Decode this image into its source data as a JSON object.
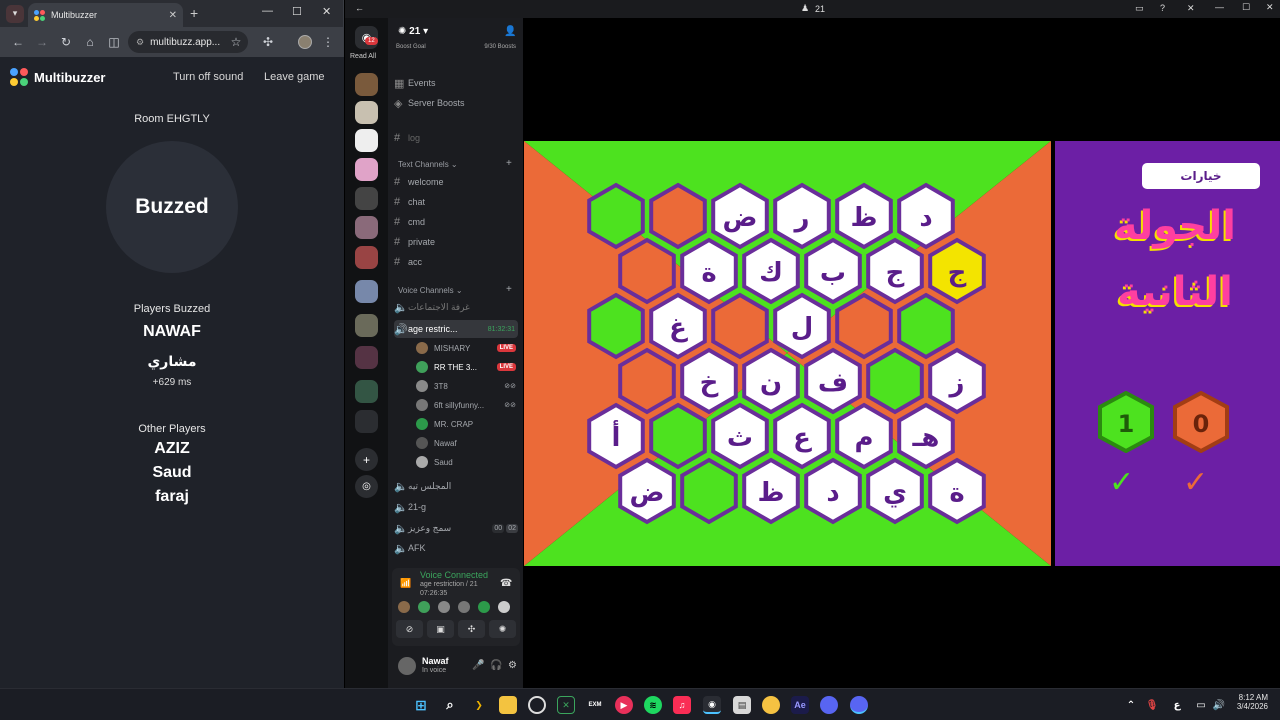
{
  "chrome": {
    "tab_title": "Multibuzzer",
    "tab_close": "✕",
    "new_tab": "+",
    "url": "multibuzz.app...",
    "window_controls": [
      "—",
      "☐",
      "✕"
    ]
  },
  "multibuzzer": {
    "app_name": "Multibuzzer",
    "turn_off_sound": "Turn off sound",
    "leave_game": "Leave game",
    "room": "Room EHGTLY",
    "buzzed": "Buzzed",
    "players_buzzed_label": "Players Buzzed",
    "buzzed_players": [
      {
        "name": "NAWAF",
        "time": ""
      },
      {
        "name": "مشاري",
        "time": "+629 ms"
      }
    ],
    "other_players_label": "Other Players",
    "other_players": [
      "AZIZ",
      "Saud",
      "faraj"
    ]
  },
  "discord": {
    "title_number": "21",
    "read_all": "Read All",
    "badge": "12",
    "server_name": "21",
    "boost_goal": "Boost Goal",
    "boost_count": "9/30 Boosts",
    "menu_items": [
      "Events",
      "Server Boosts"
    ],
    "log_channel": "log",
    "text_channels_label": "Text Channels",
    "text_channels": [
      "welcome",
      "chat",
      "cmd",
      "private",
      "acc"
    ],
    "voice_channels_label": "Voice Channels",
    "voice_channel_meeting": "غرفة الاجتماعات",
    "active_voice_channel": "age restric...",
    "active_voice_timer": "81:32:31",
    "voice_users": [
      {
        "name": "MISHARY",
        "live": "LIVE",
        "color": "#8a6a4a"
      },
      {
        "name": "RR THE 3...",
        "live": "LIVE",
        "color": "#3fa05a"
      },
      {
        "name": "3T8",
        "live": "",
        "color": "#8a8a8a"
      },
      {
        "name": "6ft sillyfunny...",
        "live": "",
        "color": "#777"
      },
      {
        "name": "MR. CRAP",
        "live": "",
        "color": "#2c9a4a"
      },
      {
        "name": "Nawaf",
        "live": "",
        "color": "#555"
      },
      {
        "name": "Saud",
        "live": "",
        "color": "#aaa"
      }
    ],
    "other_voice_channels": [
      "المجلس تيه",
      "21-g",
      "سمج وعزيز",
      "AFK"
    ],
    "vc_counts": [
      "00",
      "02"
    ],
    "voice_connected": "Voice Connected",
    "voice_location": "age restriction / 21",
    "voice_timer": "07:26:35",
    "user_name": "Nawaf",
    "user_status": "In voice"
  },
  "game": {
    "options_button": "خيارات",
    "round_title_line1": "الجولة",
    "round_title_line2": "الثانية",
    "score_green": "1",
    "score_orange": "0",
    "check": "✓",
    "colors": {
      "green": "#4de21f",
      "orange": "#eb6a38",
      "purple": "#6c1fa5",
      "yellow": "#f3e400",
      "hex_border": "#6a2e9a"
    },
    "rows": [
      [
        {
          "t": "",
          "c": "green"
        },
        {
          "t": "",
          "c": "orange"
        },
        {
          "t": "ض",
          "c": "white"
        },
        {
          "t": "ر",
          "c": "white"
        },
        {
          "t": "ظ",
          "c": "white"
        },
        {
          "t": "د",
          "c": "white"
        }
      ],
      [
        {
          "t": "",
          "c": "orange"
        },
        {
          "t": "ة",
          "c": "white"
        },
        {
          "t": "ك",
          "c": "white"
        },
        {
          "t": "ب",
          "c": "white"
        },
        {
          "t": "ج",
          "c": "white"
        },
        {
          "t": "ج",
          "c": "yellow"
        }
      ],
      [
        {
          "t": "",
          "c": "green"
        },
        {
          "t": "غ",
          "c": "white"
        },
        {
          "t": "",
          "c": "orange"
        },
        {
          "t": "ل",
          "c": "white"
        },
        {
          "t": "",
          "c": "orange"
        },
        {
          "t": "",
          "c": "green"
        }
      ],
      [
        {
          "t": "",
          "c": "orange"
        },
        {
          "t": "خ",
          "c": "white"
        },
        {
          "t": "ن",
          "c": "white"
        },
        {
          "t": "ف",
          "c": "white"
        },
        {
          "t": "",
          "c": "green"
        },
        {
          "t": "ز",
          "c": "white"
        }
      ],
      [
        {
          "t": "أ",
          "c": "white"
        },
        {
          "t": "",
          "c": "green"
        },
        {
          "t": "ث",
          "c": "white"
        },
        {
          "t": "ع",
          "c": "white"
        },
        {
          "t": "م",
          "c": "white"
        },
        {
          "t": "هـ",
          "c": "white"
        }
      ],
      [
        {
          "t": "ض",
          "c": "white"
        },
        {
          "t": "",
          "c": "green"
        },
        {
          "t": "ظ",
          "c": "white"
        },
        {
          "t": "د",
          "c": "white"
        },
        {
          "t": "ي",
          "c": "white"
        },
        {
          "t": "ة",
          "c": "white"
        }
      ]
    ]
  },
  "taskbar": {
    "time": "8:12 AM",
    "date": "3/4/2026",
    "lang": "ع"
  }
}
